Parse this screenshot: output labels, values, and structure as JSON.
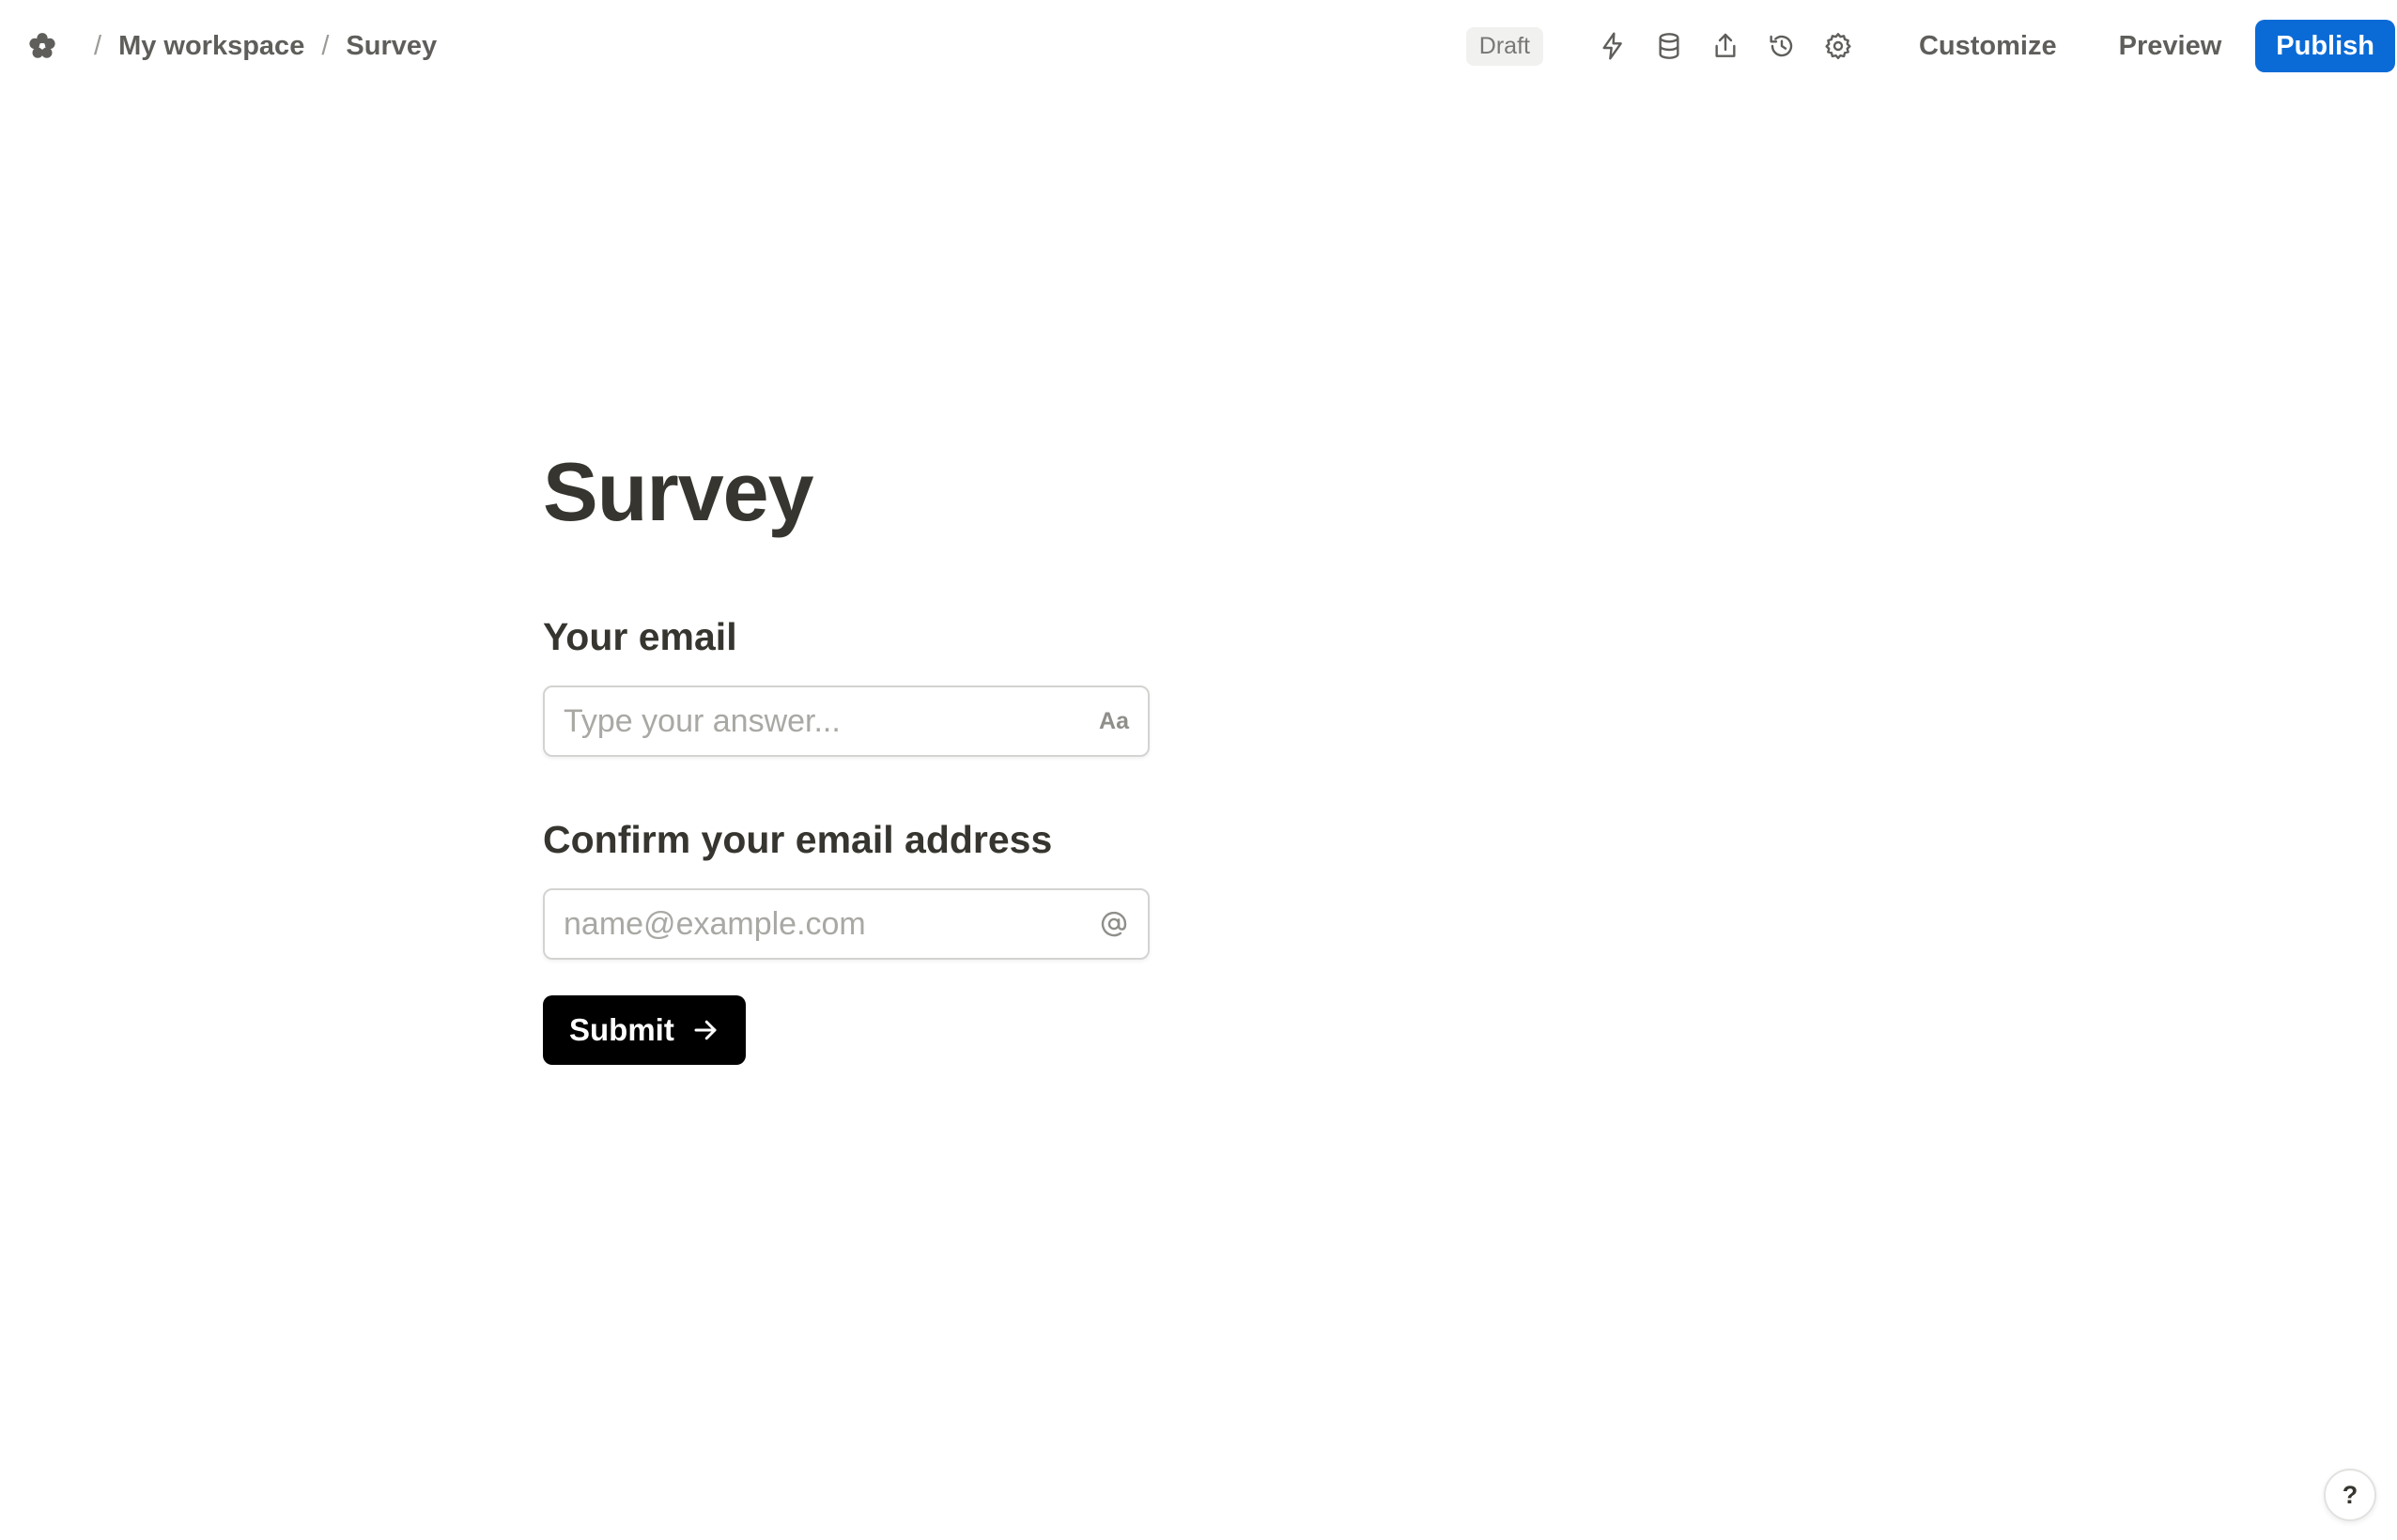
{
  "breadcrumb": {
    "logo_icon": "flower-logo-icon",
    "workspace": "My workspace",
    "page": "Survey",
    "separator": "/"
  },
  "toolbar": {
    "status": "Draft",
    "icons": [
      "lightning-icon",
      "database-icon",
      "share-icon",
      "history-icon",
      "gear-icon"
    ],
    "customize_label": "Customize",
    "preview_label": "Preview",
    "publish_label": "Publish",
    "publish_color": "#0b6bd6"
  },
  "form": {
    "title": "Survey",
    "questions": [
      {
        "label": "Your email",
        "placeholder": "Type your answer...",
        "suffix": "Aa",
        "suffix_icon": "text-format-icon"
      },
      {
        "label": "Confirm your email address",
        "placeholder": "name@example.com",
        "suffix_icon": "at-sign-icon"
      }
    ],
    "submit_label": "Submit",
    "submit_icon": "arrow-right-icon"
  },
  "help": {
    "label": "?"
  }
}
